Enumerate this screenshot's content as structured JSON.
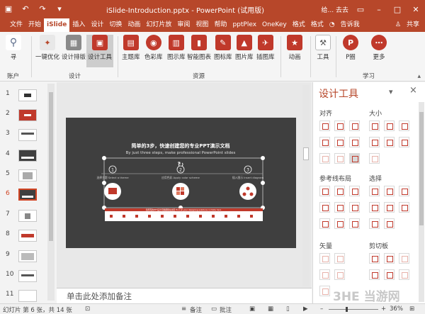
{
  "titlebar": {
    "title": "iSlide-Introduction.pptx - PowerPoint (试用版)",
    "user": "给... 去去"
  },
  "tabs": [
    "文件",
    "开始",
    "iSlide",
    "插入",
    "设计",
    "切换",
    "动画",
    "幻灯片放",
    "审阅",
    "视图",
    "帮助",
    "pptPlex",
    "OneKey",
    "格式",
    "格式"
  ],
  "tell_me": "告诉我",
  "share": "共享",
  "ribbon": {
    "account_btn": "寻",
    "account_group": "账户",
    "design_btns": [
      "一键优化",
      "设计排版",
      "设计工具"
    ],
    "design_group": "设计",
    "resource_btns": [
      "主题库",
      "色彩库",
      "图示库",
      "智能图表",
      "图标库",
      "图片库",
      "插图库"
    ],
    "resource_group": "资源",
    "anim_btn": "动画",
    "tools_btn": "工具",
    "p_btn": "P圈",
    "learn_btn": "更多",
    "learn_group": "学习"
  },
  "thumbnails": [
    "1",
    "2",
    "3",
    "4",
    "5",
    "6",
    "7",
    "8",
    "9",
    "10",
    "11"
  ],
  "slide": {
    "title_cn": "简单的3步，快速创建您的专业PPT演示文档",
    "title_en": "By just three steps, make professional PowerPoint slides",
    "step_nums": [
      "1",
      "2",
      "3"
    ],
    "step_labels": [
      "选择主题 Select a theme",
      "应用色彩 Apply color scheme",
      "插入图示 Insert diagram"
    ],
    "footer_text": "您所有的PPT设计问题都能在这里 Find all your designing solutions in iSlide here"
  },
  "notes": "单击此处添加备注",
  "panel": {
    "title": "设计工具",
    "dropdown": "▾",
    "close": "×",
    "sections": [
      "对齐",
      "大小",
      "参考线布局",
      "选择",
      "矢量",
      "剪切板"
    ]
  },
  "status": {
    "slide_info": "幻灯片 第 6 张，共 14 张",
    "notes_btn": "备注",
    "comments_btn": "批注",
    "zoom": "36%"
  },
  "watermark": "3HE 当游网",
  "colors": {
    "accent": "#b7472a",
    "slide_bg": "#3f3f3f"
  }
}
